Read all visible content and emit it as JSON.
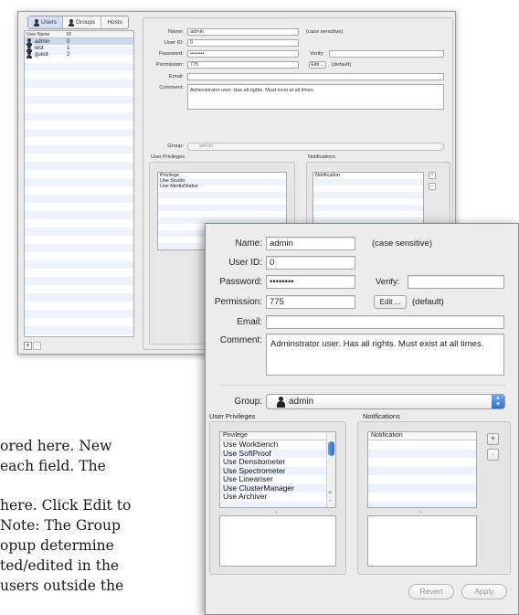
{
  "document": {
    "lines": [
      "ored  here.  New",
      "each  field.  The",
      "here. Click Edit to",
      "Note: The Group",
      "opup  determine",
      "ted/edited in the",
      "users outside the"
    ]
  },
  "back_window": {
    "segments": [
      "Users",
      "Groups",
      "Hosts"
    ],
    "list_headers": [
      "User Name",
      "ID"
    ],
    "users": [
      {
        "name": "admin",
        "id": "0"
      },
      {
        "name": "test",
        "id": "1"
      },
      {
        "name": "guest",
        "id": "2"
      }
    ],
    "labels": {
      "name": "Name:",
      "user_id": "User ID:",
      "password": "Password:",
      "verify": "Verify:",
      "permission": "Permission:",
      "email": "Email:",
      "comment": "Comment:",
      "group": "Group:",
      "user_privileges": "User Privileges",
      "notifications": "Notifications"
    },
    "values": {
      "name": "admin",
      "name_note": "(case sensitive)",
      "user_id": "0",
      "password": "••••••••",
      "permission": "775",
      "edit_button": "Edit ...",
      "default_note": "(default)",
      "comment": "Administrator user.  Has all rights.  Must exist at all times.",
      "group": "admin"
    },
    "privileges_header": "Privilege",
    "privileges": [
      "Use Studio",
      "Use MediaStatus"
    ],
    "notifications_header": "Notification",
    "add_symbol": "+",
    "remove_symbol": "-"
  },
  "front_window": {
    "labels": {
      "name": "Name:",
      "user_id": "User ID:",
      "password": "Password:",
      "verify": "Verify:",
      "permission": "Permission:",
      "email": "Email:",
      "comment": "Comment:",
      "group": "Group:",
      "user_privileges": "User Privileges",
      "notifications": "Notifications"
    },
    "values": {
      "name": "admin",
      "name_note": "(case sensitive)",
      "user_id": "0",
      "password": "••••••••",
      "verify": "",
      "permission": "775",
      "edit_button": "Edit ...",
      "default_note": "(default)",
      "email": "",
      "comment": "Adminstrator user.  Has all rights.  Must exist at all times.",
      "group": "admin"
    },
    "privileges_header": "Privilege",
    "privileges": [
      "Use Workbench",
      "Use SoftProof",
      "Use Densitometer",
      "Use Spectrometer",
      "Use Lineariser",
      "Use ClusterManager",
      "Use Archiver"
    ],
    "notifications_header": "Notification",
    "add_symbol": "+",
    "remove_symbol": "-",
    "revert_button": "Revert",
    "apply_button": "Apply"
  },
  "colors": {
    "accent_blue": "#2a6ed8",
    "window_bg": "#ececec",
    "selection": "#c9daf5"
  }
}
